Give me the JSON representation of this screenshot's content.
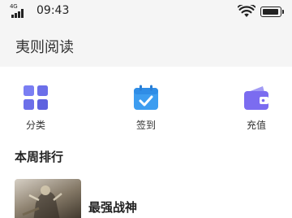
{
  "status_bar": {
    "network": "4G",
    "time": "09:43"
  },
  "app": {
    "title": "夷则阅读"
  },
  "features": [
    {
      "label": "分类",
      "icon": "grid-icon",
      "color": "#6f72f0"
    },
    {
      "label": "签到",
      "icon": "calendar-check-icon",
      "color": "#3d9df0"
    },
    {
      "label": "充值",
      "icon": "wallet-icon",
      "color": "#7b6cf0"
    }
  ],
  "weekly_ranking": {
    "title": "本周排行",
    "items": [
      {
        "title": "最强战神"
      }
    ]
  }
}
